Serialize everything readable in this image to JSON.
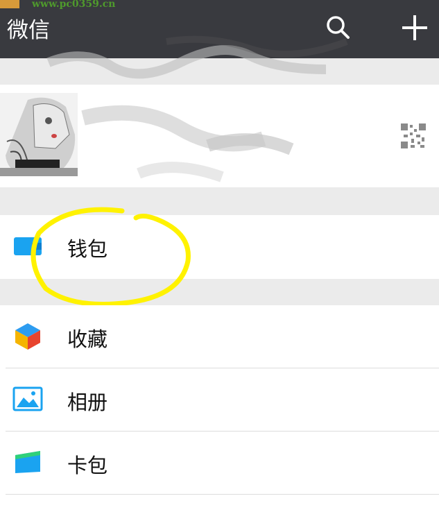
{
  "watermark": {
    "text": "www.pc0359.cn"
  },
  "header": {
    "title": "微信",
    "search_icon": "search-icon",
    "add_icon": "plus-icon"
  },
  "profile": {
    "qr_icon": "qr-code-icon"
  },
  "menu": {
    "wallet": {
      "label": "钱包",
      "icon": "wallet-icon"
    },
    "favorites": {
      "label": "收藏",
      "icon": "cube-icon"
    },
    "album": {
      "label": "相册",
      "icon": "photo-icon"
    },
    "cards": {
      "label": "卡包",
      "icon": "card-icon"
    }
  },
  "colors": {
    "header_bg": "#393a3f",
    "page_bg": "#ebebeb",
    "highlight": "#fff200",
    "accent_blue": "#1aa3f0"
  }
}
